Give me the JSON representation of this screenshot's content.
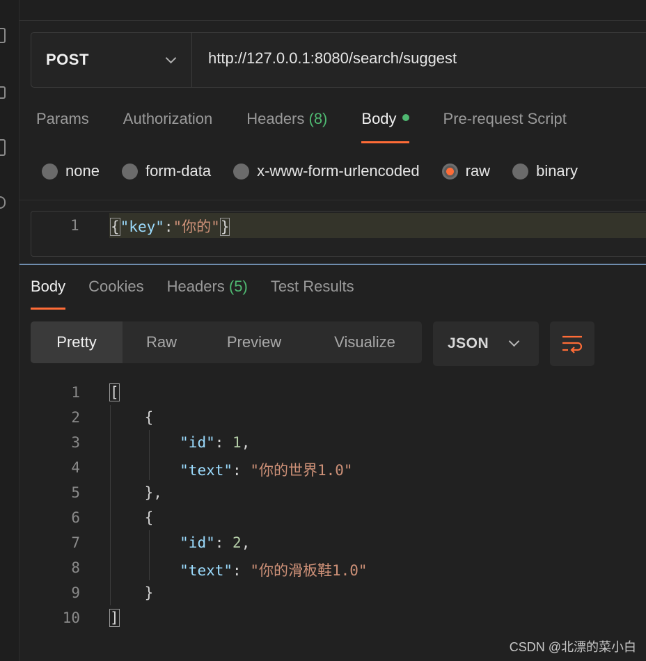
{
  "request": {
    "method": "POST",
    "url": "http://127.0.0.1:8080/search/suggest"
  },
  "request_tabs": [
    {
      "label": "Params"
    },
    {
      "label": "Authorization"
    },
    {
      "label": "Headers",
      "count": "(8)"
    },
    {
      "label": "Body",
      "active": true
    },
    {
      "label": "Pre-request Script"
    }
  ],
  "body_types": [
    {
      "label": "none"
    },
    {
      "label": "form-data"
    },
    {
      "label": "x-www-form-urlencoded"
    },
    {
      "label": "raw",
      "selected": true
    },
    {
      "label": "binary"
    }
  ],
  "request_body": {
    "line_number": "1",
    "open_brace": "{",
    "key": "\"key\"",
    "colon": ":",
    "value": "\"你的\"",
    "close_brace": "}"
  },
  "response_tabs": [
    {
      "label": "Body",
      "active": true
    },
    {
      "label": "Cookies"
    },
    {
      "label": "Headers",
      "count": "(5)"
    },
    {
      "label": "Test Results"
    }
  ],
  "view_modes": [
    "Pretty",
    "Raw",
    "Preview",
    "Visualize"
  ],
  "format": "JSON",
  "response_lines": [
    {
      "n": "1",
      "parts": [
        [
          "[",
          "p"
        ]
      ]
    },
    {
      "n": "2",
      "parts": [
        [
          "    {",
          "p"
        ]
      ]
    },
    {
      "n": "3",
      "parts": [
        [
          "        ",
          "p"
        ],
        [
          "\"id\"",
          "k"
        ],
        [
          ": ",
          "p"
        ],
        [
          "1",
          "num"
        ],
        [
          ",",
          "p"
        ]
      ]
    },
    {
      "n": "4",
      "parts": [
        [
          "        ",
          "p"
        ],
        [
          "\"text\"",
          "k"
        ],
        [
          ": ",
          "p"
        ],
        [
          "\"你的世界1.0\"",
          "s"
        ]
      ]
    },
    {
      "n": "5",
      "parts": [
        [
          "    },",
          "p"
        ]
      ]
    },
    {
      "n": "6",
      "parts": [
        [
          "    {",
          "p"
        ]
      ]
    },
    {
      "n": "7",
      "parts": [
        [
          "        ",
          "p"
        ],
        [
          "\"id\"",
          "k"
        ],
        [
          ": ",
          "p"
        ],
        [
          "2",
          "num"
        ],
        [
          ",",
          "p"
        ]
      ]
    },
    {
      "n": "8",
      "parts": [
        [
          "        ",
          "p"
        ],
        [
          "\"text\"",
          "k"
        ],
        [
          ": ",
          "p"
        ],
        [
          "\"你的滑板鞋1.0\"",
          "s"
        ]
      ]
    },
    {
      "n": "9",
      "parts": [
        [
          "    }",
          "p"
        ]
      ]
    },
    {
      "n": "10",
      "parts": [
        [
          "]",
          "p"
        ]
      ]
    }
  ],
  "watermark": "CSDN @北漂的菜小白",
  "colors": {
    "accent": "#ff6c37",
    "count_green": "#4fb871",
    "json_key": "#9cdcfe",
    "json_string": "#ce9178",
    "json_number": "#b5cea8"
  }
}
